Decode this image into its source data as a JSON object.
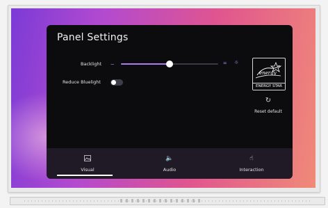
{
  "panel": {
    "title": "Panel Settings",
    "backlight": {
      "label": "Backlight",
      "value_fraction": 0.5
    },
    "reduce_bluelight": {
      "label": "Reduce Bluelight",
      "enabled": false
    },
    "energy_star": {
      "label": "ENERGY STAR",
      "script": "energy"
    },
    "reset": {
      "label": "Reset default"
    }
  },
  "tabs": [
    {
      "label": "Visual",
      "active": true,
      "icon": "image-icon"
    },
    {
      "label": "Audio",
      "active": false,
      "icon": "speaker-icon"
    },
    {
      "label": "Interaction",
      "active": false,
      "icon": "touch-icon"
    }
  ],
  "colors": {
    "accent": "#a77df0",
    "panel_bg": "#0c0c0f",
    "tabbar_bg": "#1f1a26"
  }
}
